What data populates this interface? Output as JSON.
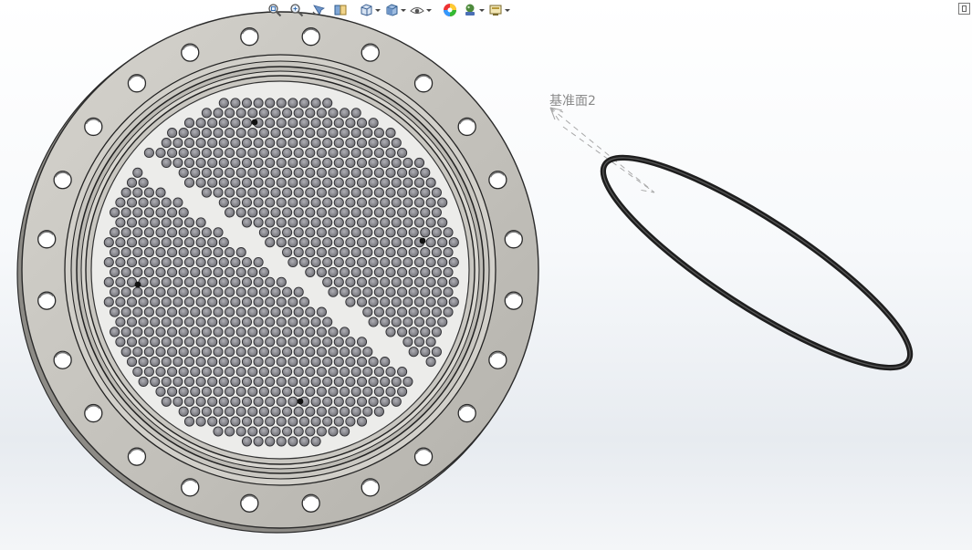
{
  "toolbar": {
    "buttons": [
      {
        "name": "zoom-to-fit-icon",
        "has_dropdown": false
      },
      {
        "name": "zoom-to-area-icon",
        "has_dropdown": false
      },
      {
        "name": "previous-view-icon",
        "has_dropdown": false
      },
      {
        "name": "section-view-icon",
        "has_dropdown": false
      },
      {
        "name": "view-orientation-icon",
        "has_dropdown": true
      },
      {
        "name": "display-style-icon",
        "has_dropdown": true
      },
      {
        "name": "hide-show-items-icon",
        "has_dropdown": true
      },
      {
        "name": "edit-appearance-icon",
        "has_dropdown": false
      },
      {
        "name": "apply-scene-icon",
        "has_dropdown": true
      },
      {
        "name": "view-settings-icon",
        "has_dropdown": true
      }
    ]
  },
  "plane_label": "基准面2",
  "model": {
    "flange_bolt_holes": 24,
    "colors": {
      "flange": "#c4c2bc",
      "flange_edge": "#2a2a2a",
      "tubesheet": "#ececea",
      "tube_hole": "#8e8e94",
      "ring": "#1e1e1e",
      "plane_line": "#a8a8a8"
    }
  }
}
